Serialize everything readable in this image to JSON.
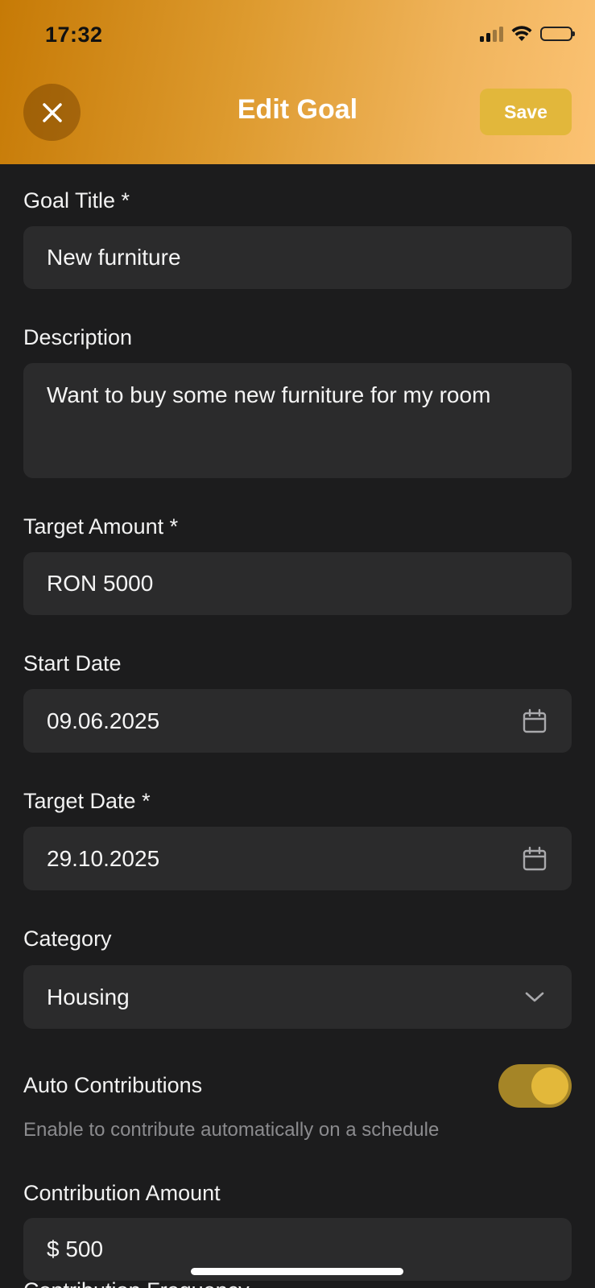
{
  "status_bar": {
    "time": "17:32"
  },
  "header": {
    "title": "Edit Goal",
    "save_label": "Save",
    "close_icon": "close-icon"
  },
  "form": {
    "goal_title": {
      "label": "Goal Title *",
      "value": "New furniture"
    },
    "description": {
      "label": "Description",
      "value": "Want to buy some new furniture for my room"
    },
    "target_amount": {
      "label": "Target Amount *",
      "value": "RON 5000"
    },
    "start_date": {
      "label": "Start Date",
      "value": "09.06.2025",
      "icon": "calendar-icon"
    },
    "target_date": {
      "label": "Target Date *",
      "value": "29.10.2025",
      "icon": "calendar-icon"
    },
    "category": {
      "label": "Category",
      "value": "Housing",
      "icon": "chevron-down-icon"
    },
    "auto_contributions": {
      "label": "Auto Contributions",
      "enabled": true,
      "helper": "Enable to contribute automatically on a schedule"
    },
    "contribution_amount": {
      "label": "Contribution Amount",
      "value": "$ 500"
    },
    "contribution_frequency": {
      "label": "Contribution Frequency"
    }
  },
  "colors": {
    "accent": "#e2b73b",
    "header_gradient_start": "#c67a06",
    "header_gradient_end": "#fbc273",
    "background": "#1c1c1d",
    "field_background": "#2b2b2c"
  }
}
